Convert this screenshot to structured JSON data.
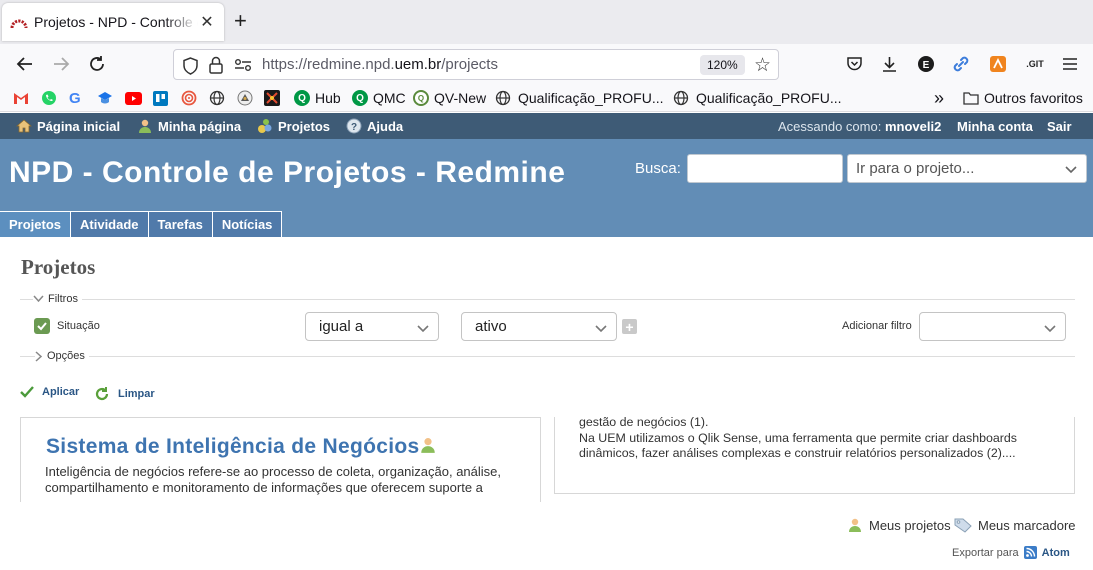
{
  "browser": {
    "tab_title": "Projetos - NPD - Controle de Projetos - Redmine",
    "tab_title_visible": "Projetos - NPD - Controle de",
    "url_prefix": "https://redmine.npd.",
    "url_domain": "uem.br",
    "url_path": "/projects",
    "zoom": "120%",
    "toolbar_icons": [
      "pocket-icon",
      "download-icon",
      "extension-e-icon",
      "link-icon",
      "extension-orange-icon",
      "git-icon",
      "menu-icon"
    ],
    "git_label": ".GIT",
    "bookmarks": [
      {
        "label": "",
        "icon": "gmail-icon",
        "color": "#ffffff"
      },
      {
        "label": "",
        "icon": "whatsapp-icon",
        "color": "#25d366"
      },
      {
        "label": "",
        "icon": "google-icon",
        "color": "#ffffff"
      },
      {
        "label": "",
        "icon": "classroom-icon",
        "color": "#ffffff"
      },
      {
        "label": "",
        "icon": "youtube-icon",
        "color": "#ff0000"
      },
      {
        "label": "",
        "icon": "trello-icon",
        "color": "#0079bf"
      },
      {
        "label": "",
        "icon": "spiral-icon",
        "color": "#ffffff"
      },
      {
        "label": "",
        "icon": "globe-icon",
        "color": "#ffffff"
      },
      {
        "label": "",
        "icon": "ufo-icon",
        "color": "#ffffff"
      },
      {
        "label": "",
        "icon": "jira-icon",
        "color": "#1a1a1a"
      },
      {
        "label": "Hub",
        "icon": "qlik-hub-icon",
        "color": "#009845"
      },
      {
        "label": "QMC",
        "icon": "qlik-qmc-icon",
        "color": "#009845"
      },
      {
        "label": "QV-New",
        "icon": "qv-icon",
        "color": "#5a8a3c"
      },
      {
        "label": "Qualificação_PROFU...",
        "icon": "globe-icon",
        "color": "#ffffff"
      },
      {
        "label": "Qualificação_PROFU...",
        "icon": "globe-icon",
        "color": "#ffffff"
      }
    ],
    "overflow_label": "»",
    "other_favorites": "Outros favoritos"
  },
  "top_menu": {
    "items": [
      "Página inicial",
      "Minha página",
      "Projetos",
      "Ajuda"
    ],
    "logged_as_label": "Acessando como:",
    "user": "mnoveli2",
    "my_account": "Minha conta",
    "logout": "Sair"
  },
  "header": {
    "title": "NPD - Controle de Projetos - Redmine",
    "search_label": "Busca:",
    "search_value": "",
    "project_jump": "Ir para o projeto..."
  },
  "main_menu": {
    "tabs": [
      "Projetos",
      "Atividade",
      "Tarefas",
      "Notícias"
    ],
    "selected": "Projetos"
  },
  "content": {
    "page_title": "Projetos",
    "filters_legend": "Filtros",
    "filter_status_label": "Situação",
    "operator_value": "igual a",
    "status_value": "ativo",
    "add_filter_label": "Adicionar filtro",
    "add_filter_value": "",
    "options_legend": "Opções",
    "apply": "Aplicar",
    "clear": "Limpar",
    "project": {
      "title": "Sistema de Inteligência de Negócios",
      "description": "Inteligência de negócios refere-se ao processo de coleta, organização, análise, compartilhamento e monitoramento de informações que oferecem suporte a"
    },
    "right_box_text_1": "gestão de negócios (1).",
    "right_box_text_2": "Na UEM utilizamos o Qlik Sense, uma ferramenta que permite criar dashboards dinâmicos, fazer análises complexas e construir relatórios personalizados (2)....",
    "my_projects": "Meus projetos",
    "my_bookmarks": "Meus marcadores",
    "export_label": "Exportar para",
    "atom": "Atom"
  },
  "colors": {
    "top_menu_bg": "#3e5b76",
    "header_bg": "#628db6",
    "link": "#2a5685",
    "project_title": "#3e74b0"
  }
}
